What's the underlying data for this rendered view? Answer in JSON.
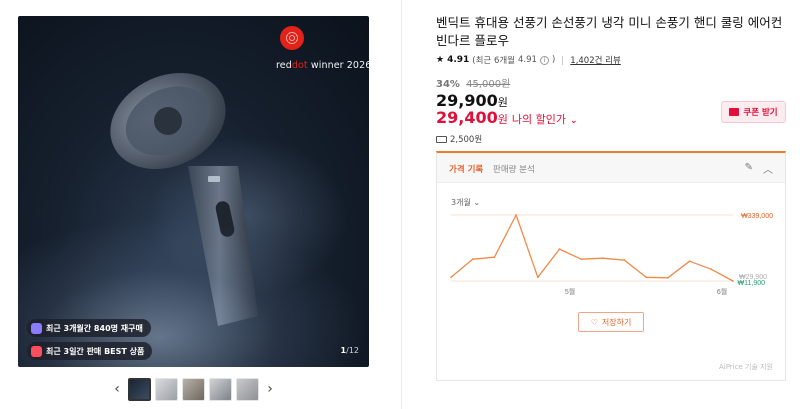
{
  "gallery": {
    "award_prefix": "red",
    "award_dot": "dot",
    "award_suffix": " winner 2026",
    "badges": [
      "최근 3개월간 840명 재구매",
      "최근 3일간 판매 BEST 상품"
    ],
    "counter_current": "1",
    "counter_total": "/12",
    "prev_icon": "chevron-left-icon",
    "next_icon": "chevron-right-icon",
    "thumbnail_count": 5
  },
  "product": {
    "title": "벤딕트 휴대용 선풍기 손선풍기 냉각 미니 손풍기 핸디 쿨링 에어컨 빈다르 플로우",
    "rating_score": "4.91",
    "rating_period": "(최근 6개월",
    "rating_period_score": "4.91",
    "rating_close": ")",
    "review_count": "1,402건 리뷰",
    "discount_rate": "34%",
    "original_price": "45,000원",
    "price": "29,900",
    "price_unit": "원",
    "my_price": "29,400",
    "my_price_unit": "원",
    "my_price_label": "나의 할인가",
    "coupon_label": "쿠폰 받기",
    "shipping": "2,500원"
  },
  "price_panel": {
    "tab_active": "가격 기록",
    "tab_inactive": "판매량 분석",
    "range": "3개월",
    "save_label": "저장하기",
    "powered_by": "AiPrice 기술 지원"
  },
  "colors": {
    "accent": "#e8632a",
    "sale": "#e0103a",
    "low": "#22a06b"
  },
  "chart_data": {
    "type": "line",
    "x_tick_labels": [
      "5월",
      "6월"
    ],
    "x_tick_positions": [
      5,
      9
    ],
    "max_label": "₩339,000",
    "current_label": "₩29,900",
    "min_label": "₩11,900",
    "ylim": [
      11900,
      339000
    ],
    "series": [
      {
        "values": [
          30000,
          120000,
          130000,
          339000,
          30000,
          170000,
          120000,
          125000,
          115000,
          30000,
          28000,
          110000,
          70000,
          11900
        ]
      }
    ]
  }
}
